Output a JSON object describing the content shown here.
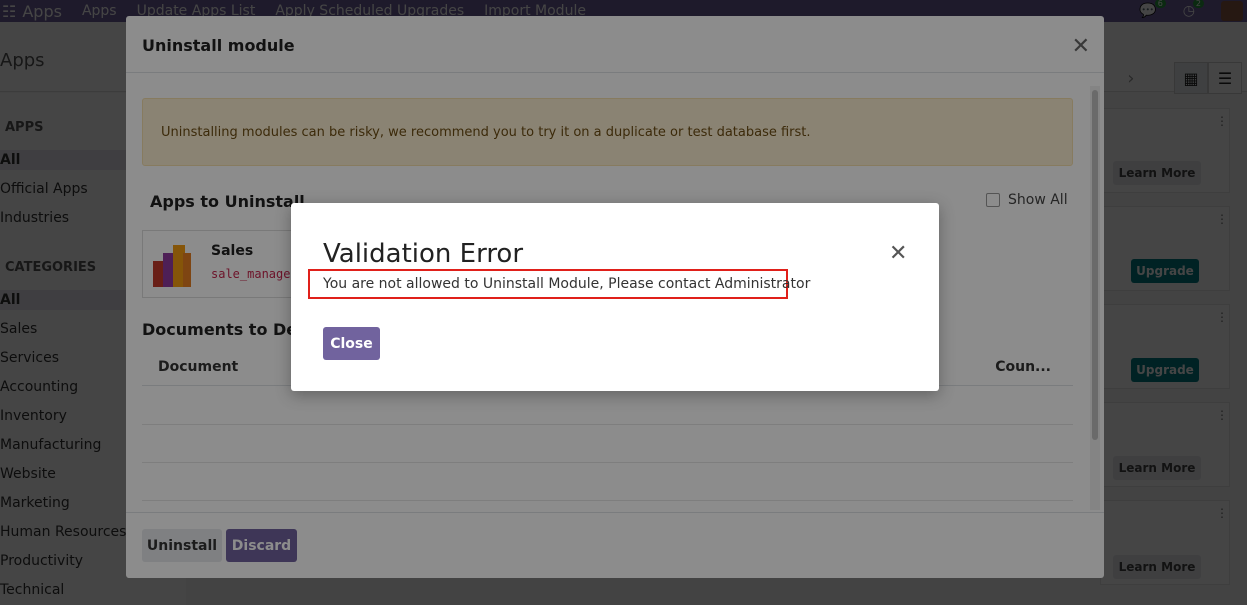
{
  "navbar": {
    "app_name": "Apps",
    "menu": [
      "Apps",
      "Update Apps List",
      "Apply Scheduled Upgrades",
      "Import Module"
    ],
    "chat_count": "6",
    "activity_count": "2"
  },
  "control_panel": {
    "breadcrumb": "Apps"
  },
  "sidebar": {
    "apps_header": "APPS",
    "apps_items": [
      "All",
      "Official Apps",
      "Industries"
    ],
    "categories_header": "CATEGORIES",
    "categories_items": [
      "All",
      "Sales",
      "Services",
      "Accounting",
      "Inventory",
      "Manufacturing",
      "Website",
      "Marketing",
      "Human Resources",
      "Productivity",
      "Technical"
    ]
  },
  "kanban_buttons": [
    "Learn More",
    "Upgrade",
    "Upgrade",
    "Learn More",
    "Learn More"
  ],
  "uninstall_dialog": {
    "title": "Uninstall module",
    "warning": "Uninstalling modules can be risky, we recommend you to try it on a duplicate or test database first.",
    "apps_section_title": "Apps to Uninstall",
    "show_all_label": "Show All",
    "app": {
      "name": "Sales",
      "technical_name": "sale_manage"
    },
    "documents_section_title": "Documents to Del",
    "table_headers": {
      "document": "Document",
      "count": "Coun..."
    },
    "buttons": {
      "uninstall": "Uninstall",
      "discard": "Discard"
    }
  },
  "validation_error": {
    "title": "Validation Error",
    "message": "You are not allowed to Uninstall Module, Please contact Administrator",
    "close_label": "Close"
  },
  "colors": {
    "brand": "#71639e",
    "upgrade": "#017e84",
    "highlight": "#e0201a",
    "warning_bg": "#fcefd2"
  }
}
